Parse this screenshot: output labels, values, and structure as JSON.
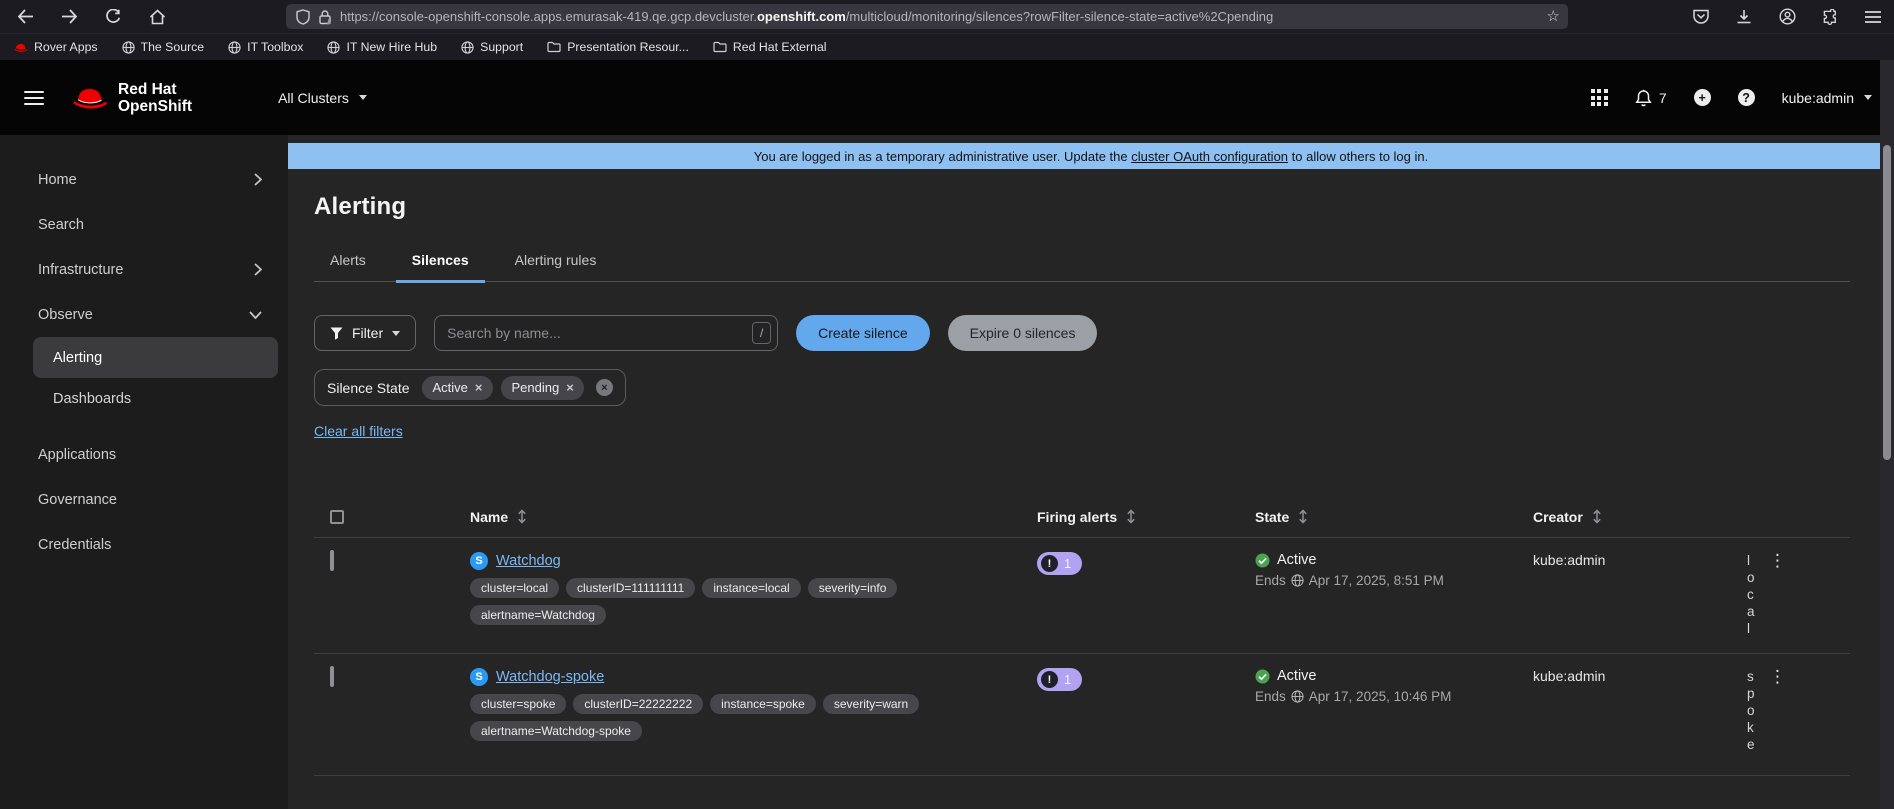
{
  "browser": {
    "url_prefix": "https://console-openshift-console.apps.emurasak-419.qe.gcp.devcluster.",
    "url_domain": "openshift.com",
    "url_suffix": "/multicloud/monitoring/silences?rowFilter-silence-state=active%2Cpending",
    "bookmarks": [
      {
        "label": "Rover Apps",
        "icon": "redhat-icon"
      },
      {
        "label": "The Source",
        "icon": "globe-icon"
      },
      {
        "label": "IT Toolbox",
        "icon": "globe-icon"
      },
      {
        "label": "IT New Hire Hub",
        "icon": "globe-icon"
      },
      {
        "label": "Support",
        "icon": "globe-icon"
      },
      {
        "label": "Presentation Resour...",
        "icon": "folder-icon"
      },
      {
        "label": "Red Hat External",
        "icon": "folder-icon"
      }
    ]
  },
  "masthead": {
    "brand_line1": "Red Hat",
    "brand_line2": "OpenShift",
    "cluster_selector": "All Clusters",
    "notification_count": "7",
    "user": "kube:admin"
  },
  "sidebar": {
    "items": [
      {
        "label": "Home"
      },
      {
        "label": "Search"
      },
      {
        "label": "Infrastructure"
      },
      {
        "label": "Observe"
      },
      {
        "label": "Alerting"
      },
      {
        "label": "Dashboards"
      },
      {
        "label": "Applications"
      },
      {
        "label": "Governance"
      },
      {
        "label": "Credentials"
      }
    ]
  },
  "banner": {
    "text_before": "You are logged in as a temporary administrative user. Update the ",
    "link": "cluster OAuth configuration",
    "text_after": " to allow others to log in."
  },
  "page": {
    "title": "Alerting",
    "tabs": [
      "Alerts",
      "Silences",
      "Alerting rules"
    ],
    "active_tab": "Silences"
  },
  "toolbar": {
    "filter_label": "Filter",
    "search_placeholder": "Search by name...",
    "search_shortcut": "/",
    "create_button": "Create silence",
    "expire_button": "Expire 0 silences",
    "chip_group_label": "Silence State",
    "chips": [
      "Active",
      "Pending"
    ],
    "clear_link": "Clear all filters"
  },
  "table": {
    "headers": [
      "Name",
      "Firing alerts",
      "State",
      "Creator"
    ],
    "rows": [
      {
        "name": "Watchdog",
        "badge": "S",
        "labels": [
          "cluster=local",
          "clusterID=111111111",
          "instance=local",
          "severity=info",
          "alertname=Watchdog"
        ],
        "firing_count": "1",
        "state": "Active",
        "ends_label": "Ends",
        "ends_date": "Apr 17, 2025, 8:51 PM",
        "creator": "kube:admin",
        "cluster": "local"
      },
      {
        "name": "Watchdog-spoke",
        "badge": "S",
        "labels": [
          "cluster=spoke",
          "clusterID=22222222",
          "instance=spoke",
          "severity=warn",
          "alertname=Watchdog-spoke"
        ],
        "firing_count": "1",
        "state": "Active",
        "ends_label": "Ends",
        "ends_date": "Apr 17, 2025, 10:46 PM",
        "creator": "kube:admin",
        "cluster": "spoke"
      }
    ]
  },
  "icons": {
    "kebab": "⋮",
    "close": "×",
    "star": "☆",
    "plus": "+",
    "question": "?",
    "exclamation": "!"
  },
  "colors": {
    "banner_bg": "#8ec1f2",
    "primary_button_blue": "#63a7ed",
    "link_blue": "#7cb9f3",
    "badge_purple": "#b1a3f2",
    "state_green": "#4aa34f",
    "silence_badge_blue": "#2b9af3",
    "redhat_red": "#ee0000"
  }
}
